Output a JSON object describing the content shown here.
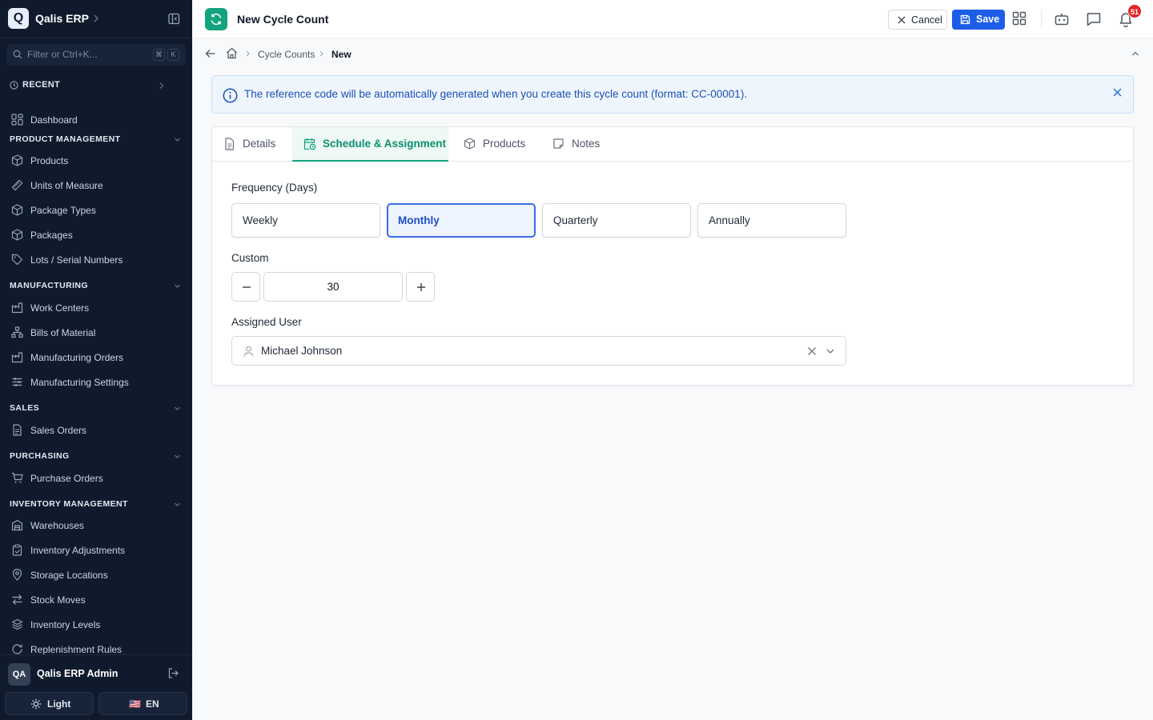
{
  "app": {
    "logo_letter": "Q",
    "name": "Qalis ERP"
  },
  "sidebar": {
    "filter_placeholder": "Filter or Ctrl+K...",
    "filter_kbd": [
      "⌘",
      "K"
    ],
    "recent_label": "RECENT",
    "dashboard_label": "Dashboard",
    "sections": [
      {
        "title": "PRODUCT MANAGEMENT",
        "items": [
          "Products",
          "Units of Measure",
          "Package Types",
          "Packages",
          "Lots / Serial Numbers"
        ]
      },
      {
        "title": "MANUFACTURING",
        "items": [
          "Work Centers",
          "Bills of Material",
          "Manufacturing Orders",
          "Manufacturing Settings"
        ]
      },
      {
        "title": "SALES",
        "items": [
          "Sales Orders"
        ]
      },
      {
        "title": "PURCHASING",
        "items": [
          "Purchase Orders"
        ]
      },
      {
        "title": "INVENTORY MANAGEMENT",
        "items": [
          "Warehouses",
          "Inventory Adjustments",
          "Storage Locations",
          "Stock Moves",
          "Inventory Levels",
          "Replenishment Rules"
        ]
      }
    ],
    "user": {
      "initials": "QA",
      "name": "Qalis ERP Admin"
    },
    "theme_label": "Light",
    "lang_flag": "🇺🇸",
    "lang_label": "EN"
  },
  "topbar": {
    "title": "New Cycle Count",
    "cancel_label": "Cancel",
    "save_label": "Save",
    "notification_count": "51"
  },
  "breadcrumb": {
    "items": [
      "Cycle Counts",
      "New"
    ]
  },
  "banner": {
    "text": "The reference code will be automatically generated when you create this cycle count (format: CC-00001)."
  },
  "tabs": [
    {
      "label": "Details",
      "icon": "document-icon",
      "active": false
    },
    {
      "label": "Schedule & Assignment",
      "icon": "calendar-clock-icon",
      "active": true
    },
    {
      "label": "Products",
      "icon": "package-icon",
      "active": false
    },
    {
      "label": "Notes",
      "icon": "note-icon",
      "active": false
    }
  ],
  "form": {
    "frequency_label": "Frequency (Days)",
    "frequency_options": [
      "Weekly",
      "Monthly",
      "Quarterly",
      "Annually"
    ],
    "frequency_selected": "Monthly",
    "custom_label": "Custom",
    "custom_value": "30",
    "assigned_user_label": "Assigned User",
    "assigned_user_value": "Michael Johnson"
  },
  "colors": {
    "sidebar_bg": "#0f1b2d",
    "brand_green": "#14a37f",
    "primary_blue": "#1d5ee8",
    "notification_red": "#e3262a"
  }
}
